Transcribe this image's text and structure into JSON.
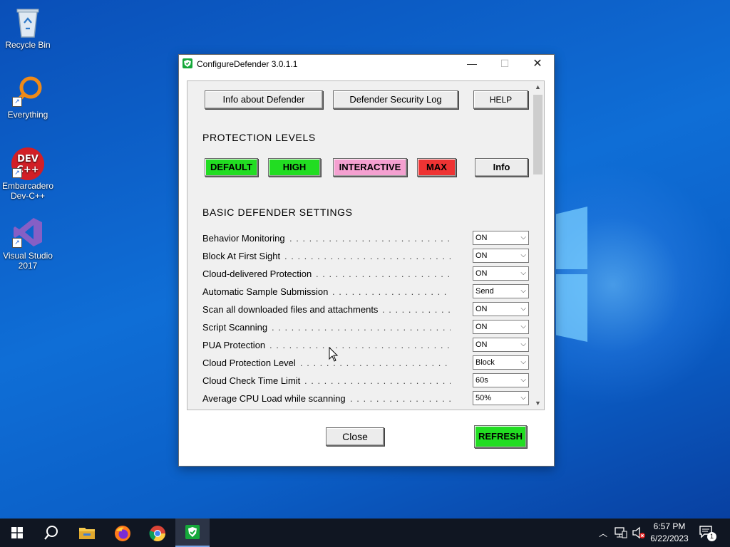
{
  "desktop": {
    "icons": [
      {
        "label": "Recycle Bin"
      },
      {
        "label": "Everything"
      },
      {
        "label": "Embarcadero Dev-C++"
      },
      {
        "label": "Visual Studio 2017"
      }
    ]
  },
  "window": {
    "title": "ConfigureDefender 3.0.1.1",
    "controls": {
      "minimize": "—",
      "maximize": "☐",
      "close": "✕"
    },
    "top_buttons": {
      "info_defender": "Info about Defender",
      "security_log": "Defender Security Log",
      "help": "HELP"
    },
    "protection_levels": {
      "heading": "PROTECTION LEVELS",
      "default": "DEFAULT",
      "high": "HIGH",
      "interactive": "INTERACTIVE",
      "max": "MAX",
      "info": "Info",
      "colors": {
        "default": "#22dd22",
        "high": "#22dd22",
        "interactive": "#f4a0d0",
        "max": "#ee3333"
      }
    },
    "basic_settings": {
      "heading": "BASIC DEFENDER SETTINGS",
      "rows": [
        {
          "label": "Behavior Monitoring",
          "value": "ON"
        },
        {
          "label": "Block At First Sight",
          "value": "ON"
        },
        {
          "label": "Cloud-delivered Protection",
          "value": "ON"
        },
        {
          "label": "Automatic Sample Submission",
          "value": "Send"
        },
        {
          "label": "Scan all downloaded files and attachments",
          "value": "ON"
        },
        {
          "label": "Script Scanning",
          "value": "ON"
        },
        {
          "label": "PUA Protection",
          "value": "ON"
        },
        {
          "label": "Cloud Protection Level",
          "value": "Block"
        },
        {
          "label": "Cloud Check Time Limit",
          "value": "60s"
        },
        {
          "label": "Average CPU Load while scanning",
          "value": "50%"
        }
      ]
    },
    "bottom": {
      "close": "Close",
      "refresh": "REFRESH"
    }
  },
  "taskbar": {
    "clock_time": "6:57 PM",
    "clock_date": "6/22/2023",
    "notification_count": "1"
  }
}
